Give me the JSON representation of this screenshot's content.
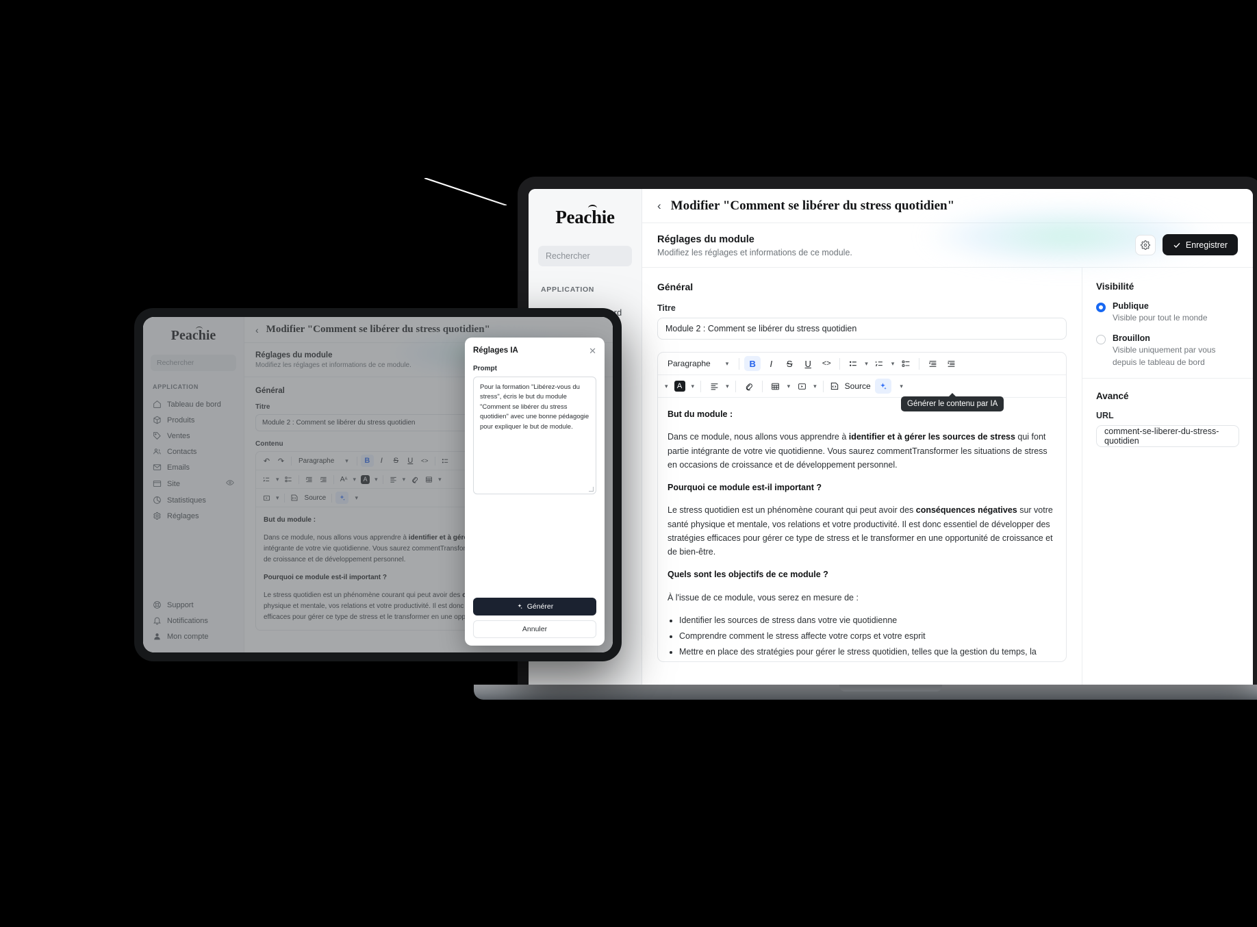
{
  "brand": {
    "name": "Peachie"
  },
  "sidebar": {
    "search_placeholder": "Rechercher",
    "section_label": "APPLICATION",
    "items": [
      {
        "label": "Tableau de bord",
        "icon": "home-icon"
      },
      {
        "label": "Produits",
        "icon": "box-icon"
      },
      {
        "label": "Ventes",
        "icon": "tag-icon"
      },
      {
        "label": "Contacts",
        "icon": "users-icon"
      },
      {
        "label": "Emails",
        "icon": "mail-icon"
      },
      {
        "label": "Site",
        "icon": "window-icon"
      },
      {
        "label": "Statistiques",
        "icon": "chart-pie-icon"
      },
      {
        "label": "Réglages",
        "icon": "gear-icon"
      }
    ],
    "bottom_items": [
      {
        "label": "Support",
        "icon": "lifebuoy-icon"
      },
      {
        "label": "Notifications",
        "icon": "bell-icon"
      },
      {
        "label": "Mon compte",
        "icon": "user-icon"
      }
    ]
  },
  "header": {
    "back_icon": "chevron-left-icon",
    "title": "Modifier \"Comment se libérer du stress quotidien\""
  },
  "subheader": {
    "title": "Réglages du module",
    "description": "Modifiez les réglages et informations de ce module.",
    "settings_icon": "gear-icon",
    "save_label": "Enregistrer",
    "save_icon": "check-icon"
  },
  "general": {
    "section_title": "Général",
    "title_label": "Titre",
    "title_value": "Module 2 : Comment se libérer du stress quotidien",
    "content_label": "Contenu"
  },
  "editor": {
    "paragraph_label": "Paragraphe",
    "source_label": "Source",
    "ai_tooltip": "Générer le contenu par IA",
    "buttons": {
      "undo": "↺",
      "redo": "↻",
      "bold": "B",
      "italic": "I",
      "strike": "S",
      "underline": "U",
      "code": "<>",
      "bullet_list": "bullet-list-icon",
      "numbered_list": "numbered-list-icon",
      "task_list": "task-list-icon",
      "outdent": "outdent-icon",
      "indent": "indent-icon",
      "font_size": "A",
      "text_color": "A",
      "align": "align-icon",
      "link": "link-icon",
      "table": "table-icon",
      "media": "media-icon",
      "source_code": "source-code-icon",
      "ai": "sparkle-icon"
    }
  },
  "document": {
    "heading1": "But du module :",
    "p1_pre": "Dans ce module, nous allons vous apprendre à ",
    "p1_bold": "identifier et à gérer les sources de stress",
    "p1_post": " qui font partie intégrante de votre vie quotidienne. Vous saurez commentTransformer les situations de stress en occasions de croissance et de développement personnel.",
    "heading2": "Pourquoi ce module est-il important ?",
    "p2_pre": "Le stress quotidien est un phénomène courant qui peut avoir des ",
    "p2_bold": "conséquences négatives",
    "p2_post": " sur votre santé physique et mentale, vos relations et votre productivité. Il est donc essentiel de développer des stratégies efficaces pour gérer ce type de stress et le transformer en une opportunité de croissance et de bien-être.",
    "heading3": "Quels sont les objectifs de ce module ?",
    "p3": "À l'issue de ce module, vous serez en mesure de :",
    "bullets": [
      "Identifier les sources de stress dans votre vie quotidienne",
      "Comprendre comment le stress affecte votre corps et votre esprit",
      "Mettre en place des stratégies pour gérer le stress quotidien, telles que la gestion du temps, la"
    ]
  },
  "visibility": {
    "section_title": "Visibilité",
    "options": [
      {
        "label": "Publique",
        "description": "Visible pour tout le monde",
        "selected": true
      },
      {
        "label": "Brouillon",
        "description": "Visible uniquement par vous depuis le tableau de bord",
        "selected": false
      }
    ]
  },
  "advanced": {
    "section_title": "Avancé",
    "url_label": "URL",
    "url_value": "comment-se-liberer-du-stress-quotidien"
  },
  "ai_modal": {
    "title": "Réglages IA",
    "close_icon": "close-icon",
    "prompt_label": "Prompt",
    "prompt_value": "Pour la formation \"Libérez-vous du stress\", écris le but du module \"Comment se libérer du stress quotidien\" avec une bonne pédagogie pour expliquer le but de module.",
    "generate_label": "Générer",
    "generate_icon": "sparkle-icon",
    "cancel_label": "Annuler"
  },
  "colors": {
    "accent_blue": "#2563eb",
    "radio_blue": "#1868f2",
    "dark_button": "#15171a",
    "sidebar_bg": "#f6f7f8"
  }
}
